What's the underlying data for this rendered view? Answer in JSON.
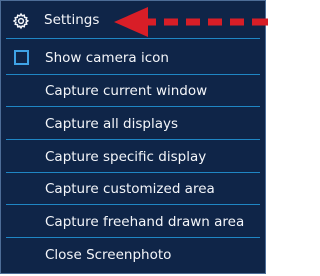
{
  "menu": {
    "settings_label": "Settings",
    "show_camera_icon": {
      "label": "Show camera icon",
      "checked": false
    },
    "items": [
      {
        "label": "Capture current window"
      },
      {
        "label": "Capture all displays"
      },
      {
        "label": "Capture specific display"
      },
      {
        "label": "Capture customized area"
      },
      {
        "label": "Capture freehand drawn area"
      },
      {
        "label": "Close Screenphoto"
      }
    ]
  },
  "colors": {
    "menu_background": "#0f2548",
    "text": "#f4f6fa",
    "divider": "#1f86c4",
    "checkbox_border": "#3fa3e6",
    "annotation_arrow": "#d81e27"
  },
  "icons": {
    "settings": "gear-icon",
    "annotation": "red-dashed-arrow-icon"
  }
}
